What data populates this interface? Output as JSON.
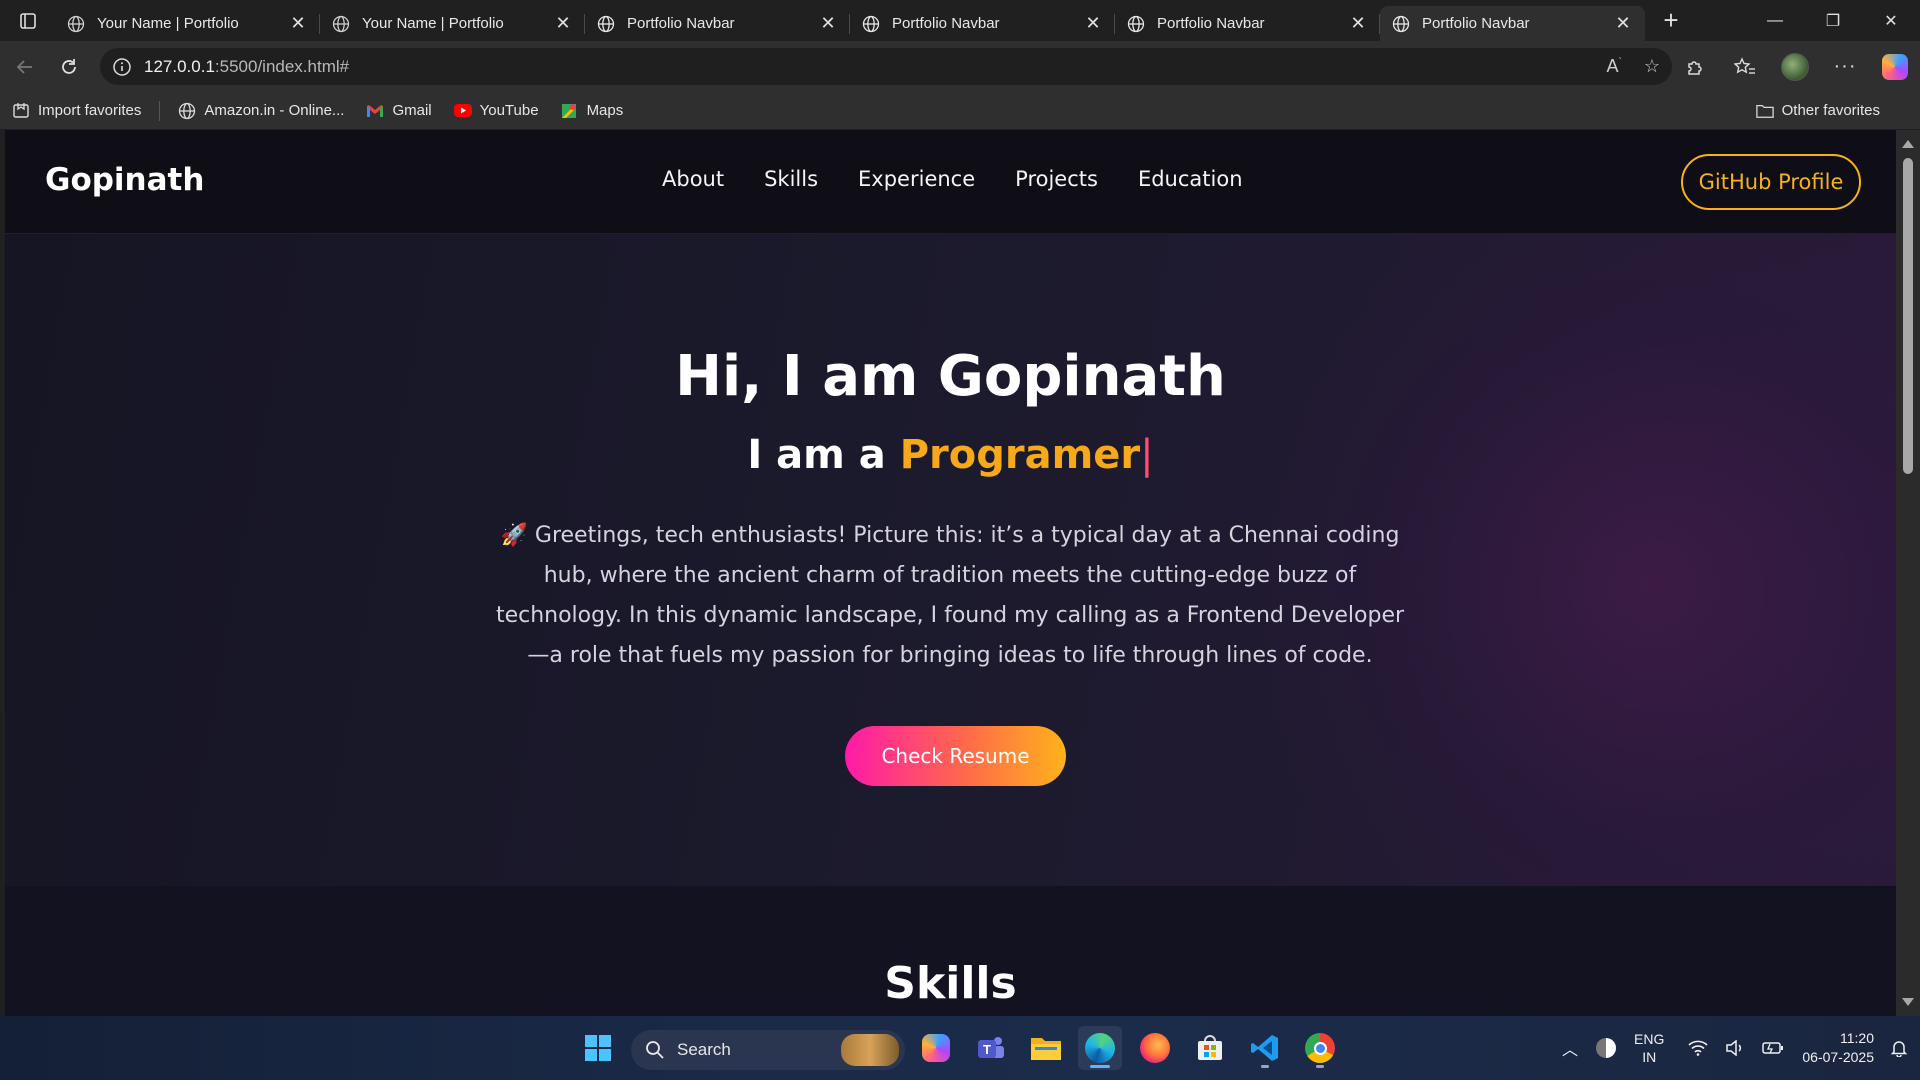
{
  "browser": {
    "tabs": [
      {
        "title": "Your Name | Portfolio",
        "active": false
      },
      {
        "title": "Your Name | Portfolio",
        "active": false
      },
      {
        "title": "Portfolio Navbar",
        "active": false
      },
      {
        "title": "Portfolio Navbar",
        "active": false
      },
      {
        "title": "Portfolio Navbar",
        "active": false
      },
      {
        "title": "Portfolio Navbar",
        "active": true
      }
    ],
    "url_host": "127.0.0.1",
    "url_path": ":5500/index.html#",
    "favorites": [
      {
        "label": "Import favorites",
        "icon": "import-icon"
      },
      {
        "label": "Amazon.in - Online...",
        "icon": "globe-icon"
      },
      {
        "label": "Gmail",
        "icon": "gmail-icon"
      },
      {
        "label": "YouTube",
        "icon": "youtube-icon"
      },
      {
        "label": "Maps",
        "icon": "maps-icon"
      }
    ],
    "other_favorites": "Other favorites"
  },
  "site": {
    "logo": "Gopinath",
    "menu": [
      "About",
      "Skills",
      "Experience",
      "Projects",
      "Education"
    ],
    "github_button": "GitHub Profile",
    "hero": {
      "title": "Hi, I am Gopinath",
      "subtitle_prefix": "I am a ",
      "subtitle_role": "Programer",
      "subtitle_cursor": "|",
      "intro": "🚀 Greetings, tech enthusiasts! Picture this: it’s a typical day at a Chennai coding hub, where the ancient charm of tradition meets the cutting-edge buzz of technology. In this dynamic landscape, I found my calling as a Frontend Developer—a role that fuels my passion for bringing ideas to life through lines of code.",
      "cta": "Check Resume"
    },
    "skills_title": "Skills"
  },
  "taskbar": {
    "search_placeholder": "Search",
    "lang_top": "ENG",
    "lang_bottom": "IN",
    "time": "11:20",
    "date": "06-07-2025"
  },
  "colors": {
    "accent": "#f6b21b",
    "cta_start": "#ff1aa8",
    "cta_end": "#ffb21a"
  }
}
